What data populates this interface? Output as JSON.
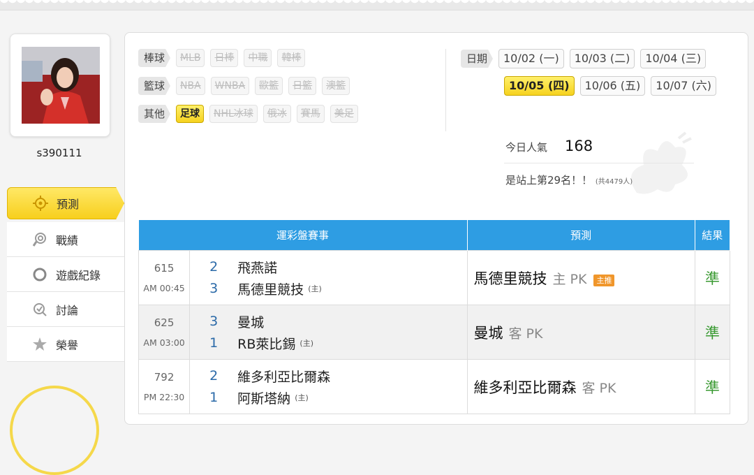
{
  "profile": {
    "username": "s390111"
  },
  "sidebar": {
    "items": [
      {
        "label": "預測",
        "icon": "target-icon",
        "active": true
      },
      {
        "label": "戰績",
        "icon": "trophy-swirl-icon",
        "active": false
      },
      {
        "label": "遊戲紀錄",
        "icon": "circle-record-icon",
        "active": false
      },
      {
        "label": "討論",
        "icon": "discussion-icon",
        "active": false
      },
      {
        "label": "榮譽",
        "icon": "honor-star-icon",
        "active": false
      }
    ]
  },
  "filters": {
    "baseball": {
      "label": "棒球",
      "items": [
        "MLB",
        "日棒",
        "中職",
        "韓棒"
      ]
    },
    "basketball": {
      "label": "籃球",
      "items": [
        "NBA",
        "WNBA",
        "歐籃",
        "日籃",
        "澳籃"
      ]
    },
    "other": {
      "label": "其他",
      "items": [
        "足球",
        "NHL冰球",
        "俄冰",
        "賽馬",
        "美足"
      ],
      "active": "足球"
    }
  },
  "dates": {
    "label": "日期",
    "items": [
      "10/02 (一)",
      "10/03 (二)",
      "10/04 (三)",
      "10/05 (四)",
      "10/06 (五)",
      "10/07 (六)"
    ],
    "active": "10/05 (四)"
  },
  "stats": {
    "popularity_label": "今日人氣",
    "popularity_value": "168",
    "rank_text": "是站上第29名！！",
    "rank_note": "(共4479人)"
  },
  "table": {
    "headers": [
      "運彩盤賽事",
      "預測",
      "結果"
    ],
    "rows": [
      {
        "game_no": "615",
        "time": "AM 00:45",
        "away_score": "2",
        "away_team": "飛燕諾",
        "home_score": "3",
        "home_team": "馬德里競技",
        "home_tag": "(主)",
        "pred_team": "馬德里競技",
        "pred_side": "主",
        "pred_line": "PK",
        "pred_badge": "主推",
        "result": "準"
      },
      {
        "game_no": "625",
        "time": "AM 03:00",
        "away_score": "3",
        "away_team": "曼城",
        "home_score": "1",
        "home_team": "RB萊比錫",
        "home_tag": "(主)",
        "pred_team": "曼城",
        "pred_side": "客",
        "pred_line": "PK",
        "pred_badge": "",
        "result": "準"
      },
      {
        "game_no": "792",
        "time": "PM 22:30",
        "away_score": "2",
        "away_team": "維多利亞比爾森",
        "home_score": "1",
        "home_team": "阿斯塔納",
        "home_tag": "(主)",
        "pred_team": "維多利亞比爾森",
        "pred_side": "客",
        "pred_line": "PK",
        "pred_badge": "",
        "result": "準"
      }
    ]
  }
}
